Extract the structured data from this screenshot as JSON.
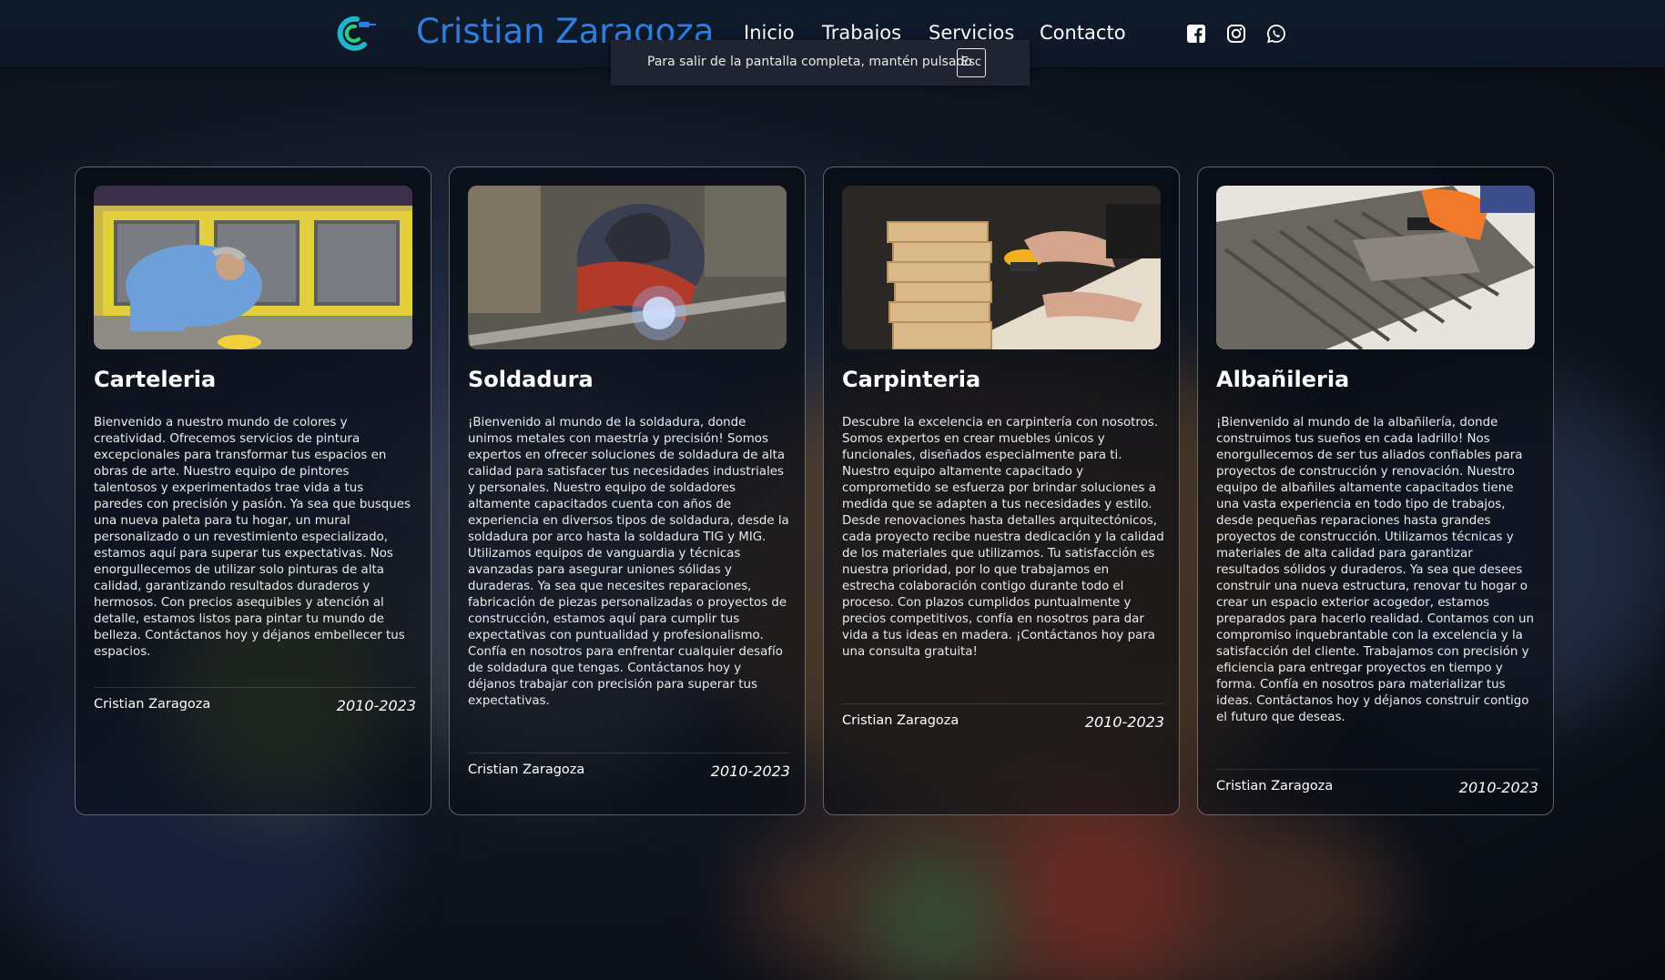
{
  "nav": {
    "brand": "Cristian Zaragoza",
    "links": [
      "Inicio",
      "Trabajos",
      "Servicios",
      "Contacto"
    ],
    "social_icons": [
      "facebook-icon",
      "instagram-icon",
      "whatsapp-icon"
    ],
    "brand_color": "#2f7fe0"
  },
  "fullscreen_toast": {
    "message": "Para salir de la pantalla completa, mantén pulsado",
    "key": "Esc"
  },
  "cards": [
    {
      "title": "Carteleria",
      "image": "painter-painting-wall-photo",
      "description": "Bienvenido a nuestro mundo de colores y creatividad. Ofrecemos servicios de pintura excepcionales para transformar tus espacios en obras de arte. Nuestro equipo de pintores talentosos y experimentados trae vida a tus paredes con precisión y pasión. Ya sea que busques una nueva paleta para tu hogar, un mural personalizado o un revestimiento especializado, estamos aquí para superar tus expectativas. Nos enorgullecemos de utilizar solo pinturas de alta calidad, garantizando resultados duraderos y hermosos. Con precios asequibles y atención al detalle, estamos listos para pintar tu mundo de belleza. Contáctanos hoy y déjanos embellecer tus espacios.",
      "author": "Cristian Zaragoza",
      "years": "2010-2023"
    },
    {
      "title": "Soldadura",
      "image": "welder-working-photo",
      "description": "¡Bienvenido al mundo de la soldadura, donde unimos metales con maestría y precisión! Somos expertos en ofrecer soluciones de soldadura de alta calidad para satisfacer tus necesidades industriales y personales. Nuestro equipo de soldadores altamente capacitados cuenta con años de experiencia en diversos tipos de soldadura, desde la soldadura por arco hasta la soldadura TIG y MIG. Utilizamos equipos de vanguardia y técnicas avanzadas para asegurar uniones sólidas y duraderas. Ya sea que necesites reparaciones, fabricación de piezas personalizadas o proyectos de construcción, estamos aquí para cumplir tus expectativas con puntualidad y profesionalismo. Confía en nosotros para enfrentar cualquier desafío de soldadura que tengas. Contáctanos hoy y déjanos trabajar con precisión para superar tus expectativas.",
      "author": "Cristian Zaragoza",
      "years": "2010-2023"
    },
    {
      "title": "Carpinteria",
      "image": "carpenter-sanding-wood-photo",
      "description": "Descubre la excelencia en carpintería con nosotros. Somos expertos en crear muebles únicos y funcionales, diseñados especialmente para ti. Nuestro equipo altamente capacitado y comprometido se esfuerza por brindar soluciones a medida que se adapten a tus necesidades y estilo. Desde renovaciones hasta detalles arquitectónicos, cada proyecto recibe nuestra dedicación y la calidad de los materiales que utilizamos. Tu satisfacción es nuestra prioridad, por lo que trabajamos en estrecha colaboración contigo durante todo el proceso. Con plazos cumplidos puntualmente y precios competitivos, confía en nosotros para dar vida a tus ideas en madera. ¡Contáctanos hoy para una consulta gratuita!",
      "author": "Cristian Zaragoza",
      "years": "2010-2023"
    },
    {
      "title": "Albañileria",
      "image": "mason-trowel-tile-photo",
      "description": "¡Bienvenido al mundo de la albañilería, donde construimos tus sueños en cada ladrillo! Nos enorgullecemos de ser tus aliados confiables para proyectos de construcción y renovación. Nuestro equipo de albañiles altamente capacitados tiene una vasta experiencia en todo tipo de trabajos, desde pequeñas reparaciones hasta grandes proyectos de construcción. Utilizamos técnicas y materiales de alta calidad para garantizar resultados sólidos y duraderos. Ya sea que desees construir una nueva estructura, renovar tu hogar o crear un espacio exterior acogedor, estamos preparados para hacerlo realidad. Contamos con un compromiso inquebrantable con la excelencia y la satisfacción del cliente. Trabajamos con precisión y eficiencia para entregar proyectos en tiempo y forma. Confía en nosotros para materializar tus ideas. Contáctanos hoy y déjanos construir contigo el futuro que deseas.",
      "author": "Cristian Zaragoza",
      "years": "2010-2023"
    }
  ]
}
